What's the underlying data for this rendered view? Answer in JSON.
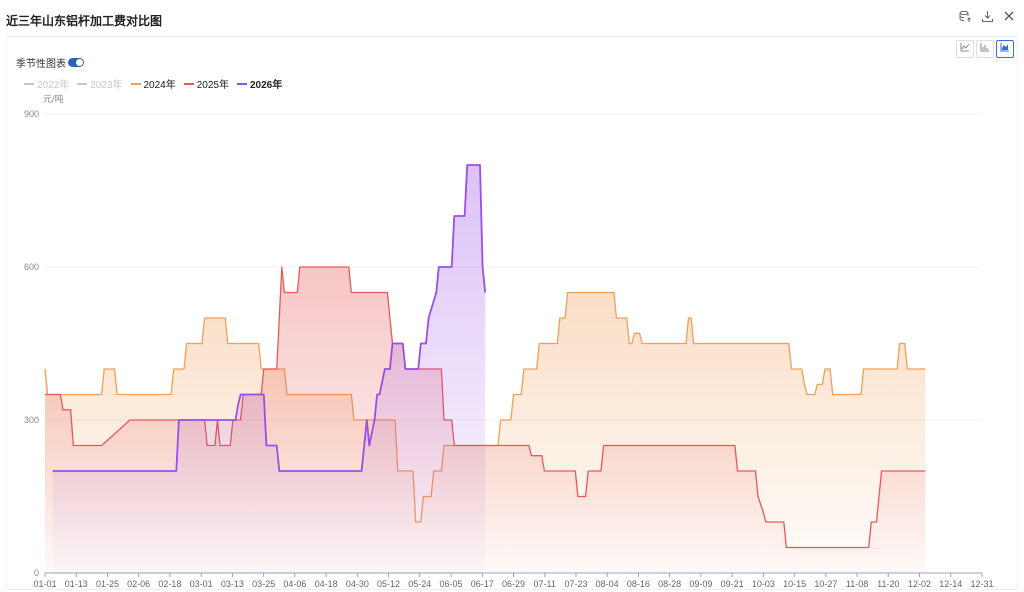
{
  "header": {
    "title": "近三年山东铝杆加工费对比图"
  },
  "icons": {
    "export": "database-export-icon",
    "download": "download-icon",
    "close": "close-icon"
  },
  "season_toggle": {
    "label": "季节性图表",
    "on": true
  },
  "view_buttons": [
    "line-chart-icon",
    "bar-chart-icon",
    "area-chart-icon"
  ],
  "chart_data": {
    "type": "area",
    "ylabel": "元/吨",
    "ylim": [
      0,
      900
    ],
    "yticks": [
      0,
      300,
      600,
      900
    ],
    "grid": true,
    "legend_position": "top-left",
    "x_ticks": [
      "01-01",
      "01-13",
      "01-25",
      "02-06",
      "02-18",
      "03-01",
      "03-13",
      "03-25",
      "04-06",
      "04-18",
      "04-30",
      "05-12",
      "05-24",
      "06-05",
      "06-17",
      "06-29",
      "07-11",
      "07-23",
      "08-04",
      "08-16",
      "08-28",
      "09-09",
      "09-21",
      "10-03",
      "10-15",
      "10-27",
      "11-08",
      "11-20",
      "12-02",
      "12-14",
      "12-31"
    ],
    "series": [
      {
        "name": "2022年",
        "color": "#c8c8c8",
        "visible": false,
        "values": []
      },
      {
        "name": "2023年",
        "color": "#c8c8c8",
        "visible": false,
        "values": []
      },
      {
        "name": "2024年",
        "color": "#f0a05a",
        "visible": true,
        "values": [
          [
            1,
            400
          ],
          [
            2,
            350
          ],
          [
            23,
            350
          ],
          [
            24,
            400
          ],
          [
            28,
            400
          ],
          [
            29,
            350
          ],
          [
            50,
            350
          ],
          [
            51,
            400
          ],
          [
            55,
            400
          ],
          [
            56,
            450
          ],
          [
            62,
            450
          ],
          [
            63,
            500
          ],
          [
            71,
            500
          ],
          [
            72,
            450
          ],
          [
            84,
            450
          ],
          [
            85,
            400
          ],
          [
            94,
            400
          ],
          [
            95,
            350
          ],
          [
            120,
            350
          ],
          [
            121,
            300
          ],
          [
            137,
            300
          ],
          [
            138,
            200
          ],
          [
            144,
            200
          ],
          [
            145,
            100
          ],
          [
            147,
            100
          ],
          [
            148,
            150
          ],
          [
            151,
            150
          ],
          [
            152,
            200
          ],
          [
            155,
            200
          ],
          [
            156,
            250
          ],
          [
            177,
            250
          ],
          [
            178,
            300
          ],
          [
            182,
            300
          ],
          [
            183,
            350
          ],
          [
            186,
            350
          ],
          [
            187,
            400
          ],
          [
            192,
            400
          ],
          [
            193,
            450
          ],
          [
            200,
            450
          ],
          [
            201,
            500
          ],
          [
            203,
            500
          ],
          [
            204,
            550
          ],
          [
            222,
            550
          ],
          [
            223,
            500
          ],
          [
            227,
            500
          ],
          [
            228,
            450
          ],
          [
            229,
            450
          ],
          [
            230,
            470
          ],
          [
            232,
            470
          ],
          [
            233,
            450
          ],
          [
            250,
            450
          ],
          [
            251,
            500
          ],
          [
            252,
            500
          ],
          [
            253,
            450
          ],
          [
            290,
            450
          ],
          [
            291,
            400
          ],
          [
            295,
            400
          ],
          [
            296,
            370
          ],
          [
            297,
            350
          ],
          [
            300,
            350
          ],
          [
            301,
            370
          ],
          [
            303,
            370
          ],
          [
            304,
            400
          ],
          [
            306,
            400
          ],
          [
            307,
            350
          ],
          [
            318,
            350
          ],
          [
            319,
            400
          ],
          [
            332,
            400
          ],
          [
            333,
            450
          ],
          [
            335,
            450
          ],
          [
            336,
            400
          ],
          [
            343,
            400
          ]
        ]
      },
      {
        "name": "2025年",
        "color": "#e85a5a",
        "visible": true,
        "values": [
          [
            1,
            350
          ],
          [
            7,
            350
          ],
          [
            8,
            320
          ],
          [
            11,
            320
          ],
          [
            12,
            250
          ],
          [
            23,
            250
          ],
          [
            34,
            300
          ],
          [
            63,
            300
          ],
          [
            64,
            250
          ],
          [
            67,
            250
          ],
          [
            68,
            300
          ],
          [
            69,
            250
          ],
          [
            73,
            250
          ],
          [
            74,
            300
          ],
          [
            77,
            300
          ],
          [
            78,
            350
          ],
          [
            85,
            350
          ],
          [
            86,
            400
          ],
          [
            91,
            400
          ],
          [
            92,
            500
          ],
          [
            93,
            600
          ],
          [
            94,
            550
          ],
          [
            99,
            550
          ],
          [
            100,
            600
          ],
          [
            119,
            600
          ],
          [
            120,
            550
          ],
          [
            134,
            550
          ],
          [
            135,
            500
          ],
          [
            136,
            450
          ],
          [
            140,
            450
          ],
          [
            141,
            400
          ],
          [
            155,
            400
          ],
          [
            156,
            300
          ],
          [
            159,
            300
          ],
          [
            160,
            250
          ],
          [
            180,
            250
          ],
          [
            181,
            250
          ],
          [
            189,
            250
          ],
          [
            190,
            230
          ],
          [
            194,
            230
          ],
          [
            195,
            200
          ],
          [
            207,
            200
          ],
          [
            208,
            150
          ],
          [
            211,
            150
          ],
          [
            212,
            200
          ],
          [
            217,
            200
          ],
          [
            218,
            250
          ],
          [
            269,
            250
          ],
          [
            270,
            200
          ],
          [
            277,
            200
          ],
          [
            278,
            150
          ],
          [
            280,
            120
          ],
          [
            281,
            100
          ],
          [
            288,
            100
          ],
          [
            289,
            50
          ],
          [
            321,
            50
          ],
          [
            322,
            100
          ],
          [
            324,
            100
          ],
          [
            325,
            150
          ],
          [
            326,
            200
          ],
          [
            343,
            200
          ]
        ]
      },
      {
        "name": "2026年",
        "color": "#9b4fe6",
        "visible": true,
        "values": [
          [
            4,
            200
          ],
          [
            52,
            200
          ],
          [
            53,
            300
          ],
          [
            67,
            300
          ],
          [
            68,
            300
          ],
          [
            71,
            300
          ],
          [
            75,
            300
          ],
          [
            76,
            330
          ],
          [
            77,
            350
          ],
          [
            86,
            350
          ],
          [
            87,
            250
          ],
          [
            91,
            250
          ],
          [
            92,
            200
          ],
          [
            124,
            200
          ],
          [
            125,
            250
          ],
          [
            126,
            300
          ],
          [
            127,
            250
          ],
          [
            129,
            300
          ],
          [
            130,
            350
          ],
          [
            131,
            350
          ],
          [
            133,
            400
          ],
          [
            135,
            400
          ],
          [
            136,
            450
          ],
          [
            140,
            450
          ],
          [
            141,
            400
          ],
          [
            146,
            400
          ],
          [
            147,
            450
          ],
          [
            149,
            450
          ],
          [
            150,
            500
          ],
          [
            153,
            550
          ],
          [
            154,
            600
          ],
          [
            159,
            600
          ],
          [
            160,
            700
          ],
          [
            164,
            700
          ],
          [
            165,
            800
          ],
          [
            170,
            800
          ],
          [
            171,
            600
          ],
          [
            172,
            550
          ]
        ]
      }
    ]
  }
}
